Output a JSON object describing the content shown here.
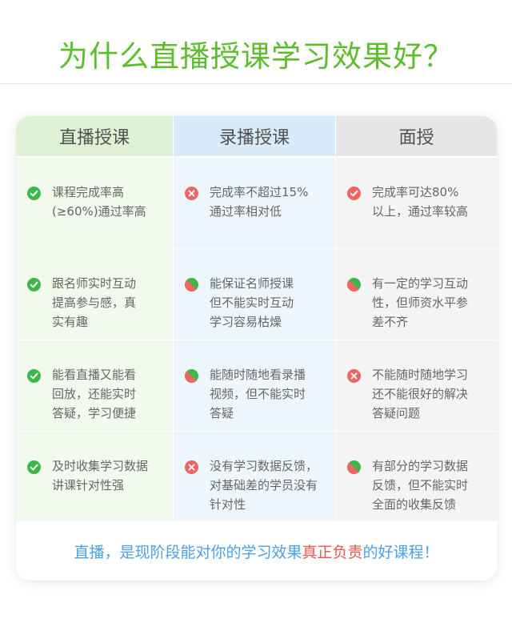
{
  "title": "为什么直播授课学习效果好？",
  "colors": {
    "title_green": "#5cbd2f",
    "check_green": "#3cb84a",
    "cross_red": "#f06464",
    "footer_blue": "#4aa1e6",
    "footer_red": "#e8574f"
  },
  "table": {
    "headers": [
      "直播授课",
      "录播授课",
      "面授"
    ],
    "rows": [
      [
        {
          "icon": "check-icon",
          "text": "课程完成率高\n(≥60%)通过率高"
        },
        {
          "icon": "cross-icon",
          "text": "完成率不超过15%\n通过率相对低"
        },
        {
          "icon": "check-red-icon",
          "text": "完成率可达80%\n以上，通过率较高"
        }
      ],
      [
        {
          "icon": "check-icon",
          "text": "跟名师实时互动\n提高参与感，真\n实有趣"
        },
        {
          "icon": "half-icon",
          "text": "能保证名师授课\n但不能实时互动\n学习容易枯燥"
        },
        {
          "icon": "half-icon",
          "text": "有一定的学习互动\n性，但师资水平参\n差不齐"
        }
      ],
      [
        {
          "icon": "check-icon",
          "text": "能看直播又能看\n回放，还能实时\n答疑，学习便捷"
        },
        {
          "icon": "half-icon",
          "text": "能随时随地看录播\n视频，但不能实时\n答疑"
        },
        {
          "icon": "cross-icon",
          "text": "不能随时随地学习\n还不能很好的解决\n答疑问题"
        }
      ],
      [
        {
          "icon": "check-icon",
          "text": "及时收集学习数据\n讲课针对性强"
        },
        {
          "icon": "cross-icon",
          "text": "没有学习数据反馈，\n对基础差的学员没有\n针对性"
        },
        {
          "icon": "half-icon",
          "text": "有部分的学习数据\n反馈，但不能实时\n全面的收集反馈"
        }
      ]
    ]
  },
  "footer": {
    "prefix": "直播，是现阶段能对你的学习效果",
    "highlight": "真正负责",
    "suffix": "的好课程！"
  }
}
